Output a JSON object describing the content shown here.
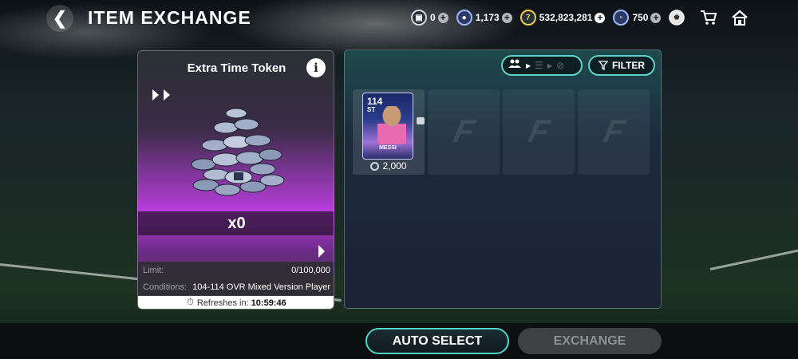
{
  "header": {
    "title": "ITEM EXCHANGE",
    "currencies": [
      {
        "name": "extra-time-token",
        "value": "0"
      },
      {
        "name": "player-token",
        "value": "1,173"
      },
      {
        "name": "coins",
        "value": "532,823,281"
      },
      {
        "name": "fc-points",
        "value": "750"
      }
    ]
  },
  "token_card": {
    "title": "Extra Time Token",
    "quantity": "x0",
    "limit_label": "Limit:",
    "limit_value": "0/100,000",
    "conditions_label": "Conditions:",
    "conditions_value": "104-114 OVR Mixed Version Player",
    "refresh_label": "Refreshes in:",
    "refresh_time": "10:59:46"
  },
  "player_panel": {
    "filter_label": "FILTER",
    "players": [
      {
        "rating": "114",
        "position": "ST",
        "name": "MESSI",
        "cost": "2,000"
      }
    ]
  },
  "footer": {
    "auto_select_label": "AUTO SELECT",
    "exchange_label": "EXCHANGE"
  },
  "colors": {
    "accent": "#4fd4c7",
    "card_purple": "#b83ddc",
    "disabled": "#3d4143"
  }
}
